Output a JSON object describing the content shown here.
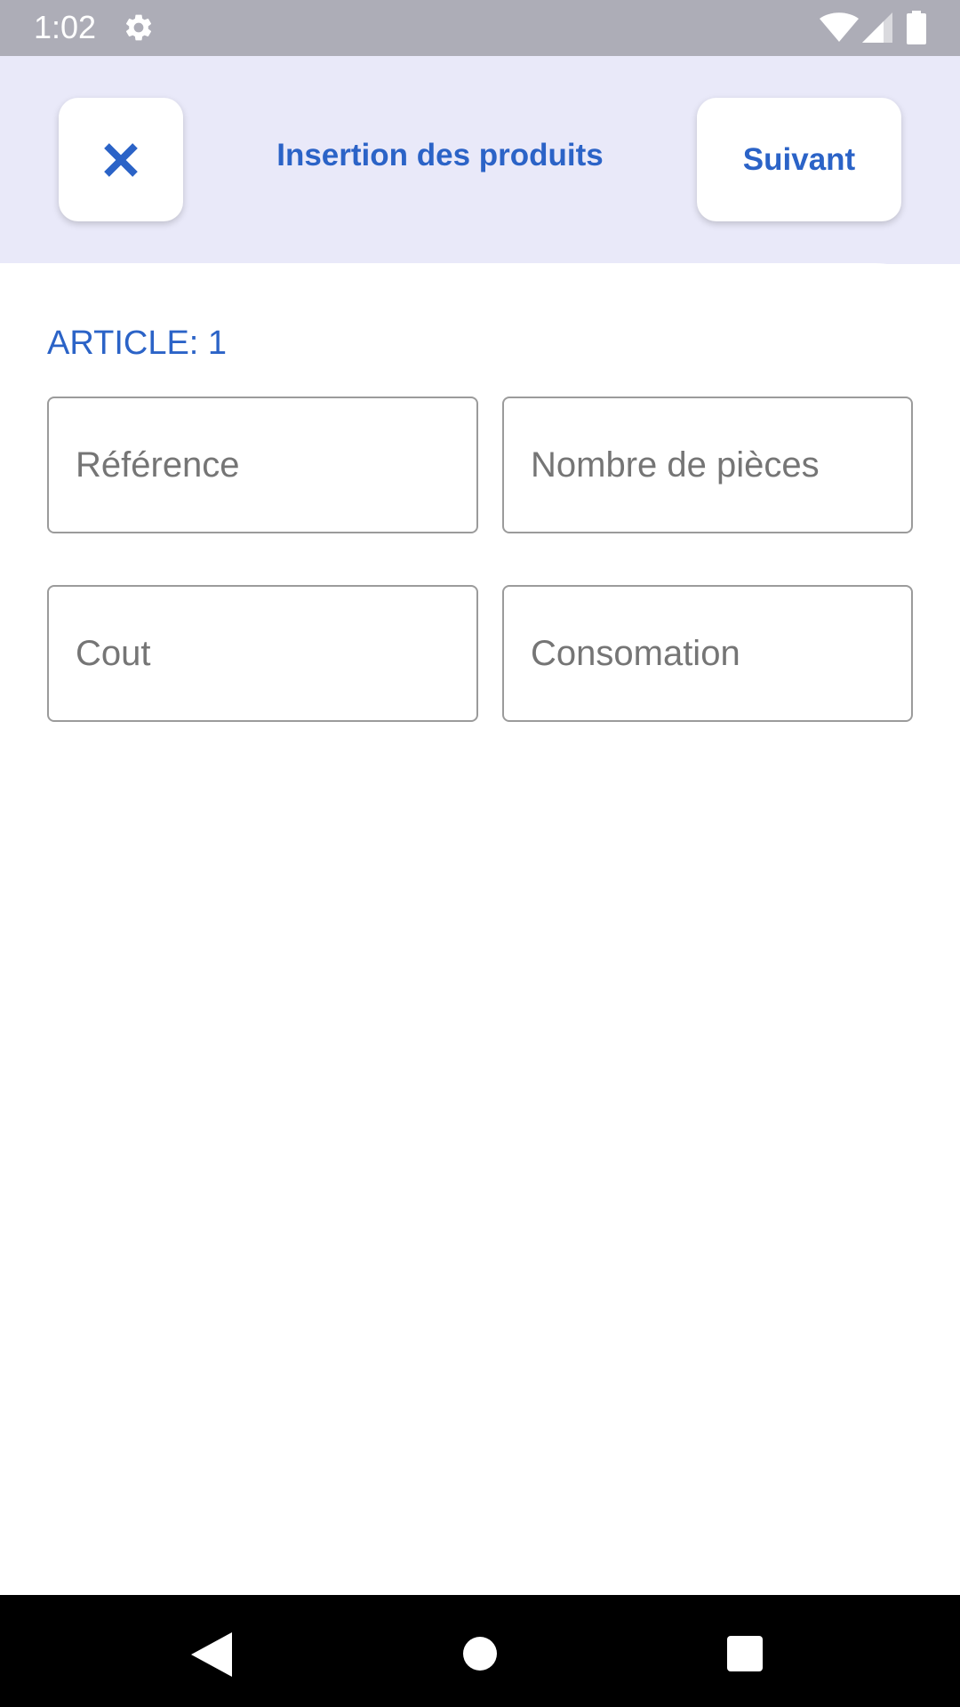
{
  "status_bar": {
    "time": "1:02",
    "icons": [
      "gear-icon",
      "wifi-icon",
      "cell-signal-icon",
      "battery-icon"
    ]
  },
  "header": {
    "close_icon": "close-icon",
    "title": "Insertion des produits",
    "next_label": "Suivant"
  },
  "form": {
    "article_label": "ARTICLE: 1",
    "fields": {
      "reference": {
        "placeholder": "Référence",
        "value": ""
      },
      "pieces": {
        "placeholder": "Nombre de pièces",
        "value": ""
      },
      "cost": {
        "placeholder": "Cout",
        "value": ""
      },
      "consumption": {
        "placeholder": "Consomation",
        "value": ""
      }
    }
  },
  "nav_bar": {
    "icons": [
      "back-icon",
      "home-icon",
      "recents-icon"
    ]
  },
  "colors": {
    "accent": "#2b63c7",
    "header_bg": "#e9e9f9",
    "status_bar_bg": "#adadb7"
  }
}
